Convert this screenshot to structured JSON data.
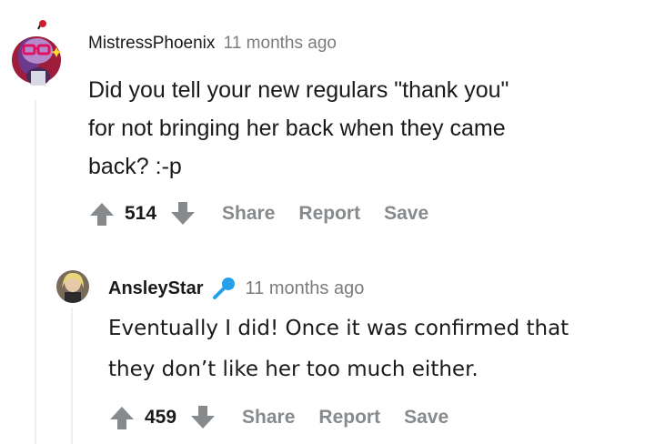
{
  "comments": [
    {
      "author": "MistressPhoenix",
      "time": "11 months ago",
      "body_lines": [
        "Did you tell your new regulars \"thank you\"",
        "for not bringing her back when they came",
        "back? :-p"
      ],
      "score": "514",
      "actions": {
        "share": "Share",
        "report": "Report",
        "save": "Save"
      },
      "avatar_icon": "snoo-avatar-icon"
    },
    {
      "author": "AnsleyStar",
      "author_flair_icon": "microphone-icon",
      "time": "11 months ago",
      "body_lines": [
        "Eventually I did! Once it was confirmed that",
        "they don’t like her too much either."
      ],
      "score": "459",
      "actions": {
        "share": "Share",
        "report": "Report",
        "save": "Save"
      },
      "avatar_icon": "user-photo-avatar"
    }
  ],
  "colors": {
    "upvote_gray": "#878a8c",
    "thread_line": "#edeff1",
    "flair_blue": "#24a0ed",
    "text": "#1a1a1b"
  }
}
